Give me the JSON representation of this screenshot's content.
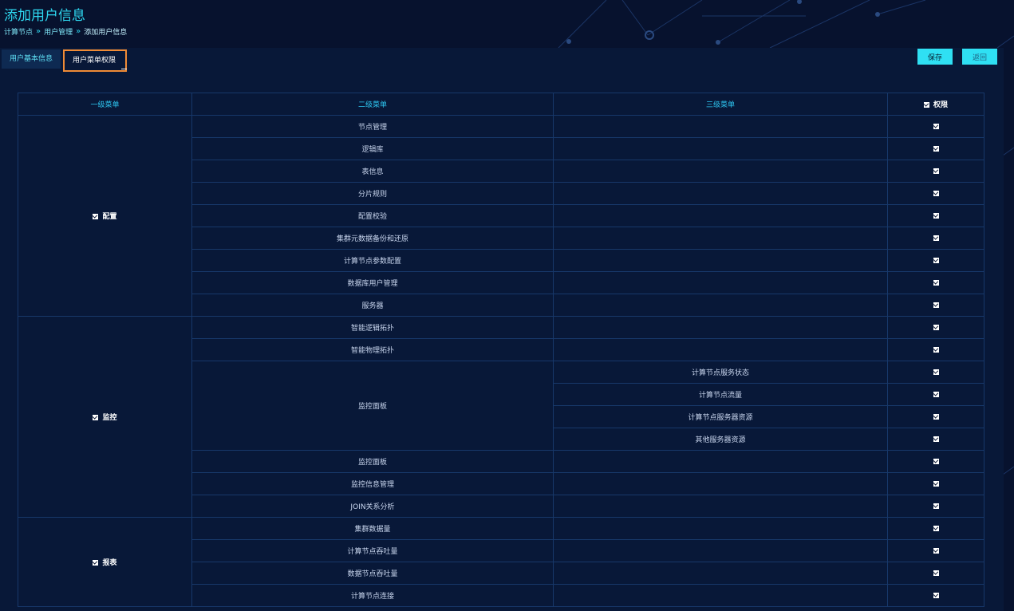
{
  "page": {
    "title": "添加用户信息",
    "breadcrumb": [
      "计算节点",
      "用户管理",
      "添加用户信息"
    ]
  },
  "tabs": [
    {
      "label": "用户基本信息",
      "active": false
    },
    {
      "label": "用户菜单权限",
      "active": true
    }
  ],
  "buttons": {
    "save": "保存",
    "back": "返回"
  },
  "table": {
    "headers": {
      "level1": "一级菜单",
      "level2": "二级菜单",
      "level3": "三级菜单",
      "permission": "权限"
    },
    "groups": [
      {
        "level1": "配置",
        "rows": [
          {
            "level2": "节点管理",
            "level3": ""
          },
          {
            "level2": "逻辑库",
            "level3": ""
          },
          {
            "level2": "表信息",
            "level3": ""
          },
          {
            "level2": "分片规则",
            "level3": ""
          },
          {
            "level2": "配置校验",
            "level3": ""
          },
          {
            "level2": "集群元数据备份和还原",
            "level3": ""
          },
          {
            "level2": "计算节点参数配置",
            "level3": ""
          },
          {
            "level2": "数据库用户管理",
            "level3": ""
          },
          {
            "level2": "服务器",
            "level3": ""
          }
        ]
      },
      {
        "level1": "监控",
        "rows": [
          {
            "level2": "智能逻辑拓扑",
            "level3": ""
          },
          {
            "level2": "智能物理拓扑",
            "level3": ""
          },
          {
            "level2": "监控面板",
            "level3": "计算节点服务状态",
            "span": 4
          },
          {
            "level2": null,
            "level3": "计算节点流量"
          },
          {
            "level2": null,
            "level3": "计算节点服务器资源"
          },
          {
            "level2": null,
            "level3": "其他服务器资源"
          },
          {
            "level2": "监控面板",
            "level3": ""
          },
          {
            "level2": "监控信息管理",
            "level3": ""
          },
          {
            "level2": "JOIN关系分析",
            "level3": ""
          }
        ]
      },
      {
        "level1": "报表",
        "rows": [
          {
            "level2": "集群数据量",
            "level3": ""
          },
          {
            "level2": "计算节点吞吐量",
            "level3": ""
          },
          {
            "level2": "数据节点吞吐量",
            "level3": ""
          },
          {
            "level2": "计算节点连接",
            "level3": ""
          }
        ]
      }
    ]
  }
}
